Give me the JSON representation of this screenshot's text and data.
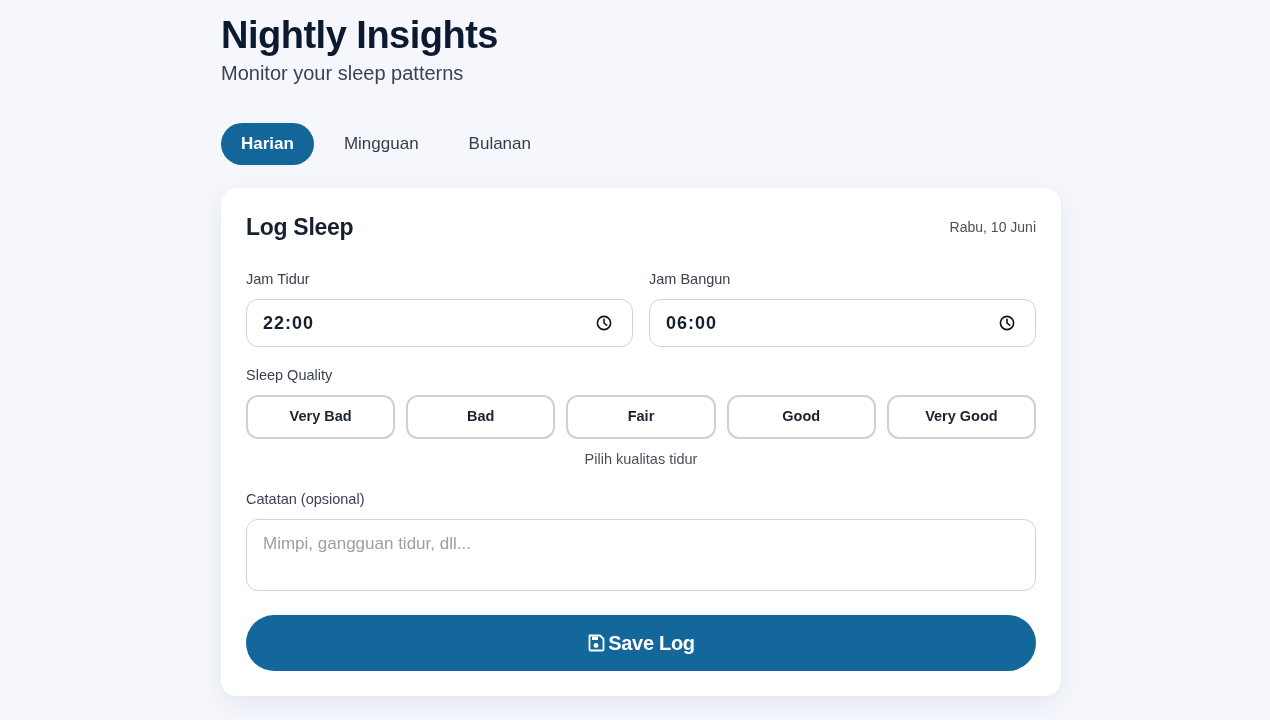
{
  "header": {
    "title": "Nightly Insights",
    "subtitle": "Monitor your sleep patterns"
  },
  "tabs": [
    {
      "label": "Harian",
      "selected": true
    },
    {
      "label": "Mingguan",
      "selected": false
    },
    {
      "label": "Bulanan",
      "selected": false
    }
  ],
  "card": {
    "title": "Log Sleep",
    "date": "Rabu, 10 Juni",
    "time_fields": [
      {
        "label": "Jam Tidur",
        "value": "22:00"
      },
      {
        "label": "Jam Bangun",
        "value": "06:00"
      }
    ],
    "quality": {
      "label": "Sleep Quality",
      "options": [
        {
          "label": "Very Bad",
          "selected": false
        },
        {
          "label": "Bad",
          "selected": false
        },
        {
          "label": "Fair",
          "selected": false
        },
        {
          "label": "Good",
          "selected": false
        },
        {
          "label": "Very Good",
          "selected": false
        }
      ],
      "hint": "Pilih kualitas tidur"
    },
    "notes": {
      "label": "Catatan (opsional)",
      "placeholder": "Mimpi, gangguan tidur, dll..."
    },
    "save_button": {
      "label": "Save Log"
    }
  }
}
